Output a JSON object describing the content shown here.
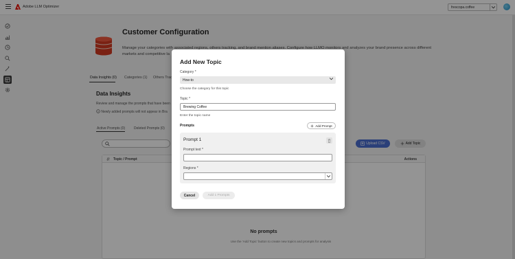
{
  "app": {
    "title": "Adobe LLM Optimizer",
    "org": "frescopa.coffee"
  },
  "sidebar": {
    "items": [
      "overview-icon",
      "chart-icon",
      "history-icon",
      "search-icon",
      "wand-icon",
      "config-icon",
      "settings-icon"
    ],
    "active_index": 5
  },
  "page": {
    "title": "Customer Configuration",
    "description": "Manage your categories with associated regions, others tracking, and brand mention aliases. Configure how LLMO monitors and analyzes your brand presence across different markets and competitive la"
  },
  "tabs": [
    "Data Insights (0)",
    "Categories (1)",
    "Others Trac"
  ],
  "section": {
    "title": "Data Insights",
    "description": "Review and manage the prompts that have been",
    "note": "Newly added prompts will not appear in Bra"
  },
  "subtabs": [
    "Active Prompts (0)",
    "Deleted Prompts (0)"
  ],
  "buttons": {
    "upload_csv": "Upload CSV",
    "add_topic": "Add Topic"
  },
  "table": {
    "headers": {
      "topic": "Topic / Prompt",
      "actions": "Actions"
    },
    "empty_title": "No prompts",
    "empty_desc": "Use the 'Add Topic' button to create new topics and prompts for analysis"
  },
  "modal": {
    "title": "Add New Topic",
    "category_label": "Category",
    "category_value": "How-to",
    "category_help": "Choose the category for this topic",
    "topic_label": "Topic",
    "topic_value": "Brewing Coffee",
    "topic_help": "Enter the topic name",
    "prompts_label": "Prompts",
    "add_prompt": "Add Prompt",
    "prompt_title": "Prompt 1",
    "prompt_text_label": "Prompt text",
    "regions_label": "Regions",
    "cancel": "Cancel",
    "add_prompts": "Add 1 Prompts",
    "required_mark": "*"
  },
  "colors": {
    "brand": "#eb1000",
    "primary_button": "#4a6ed0",
    "overlay": "rgba(0,0,0,0.42)"
  }
}
